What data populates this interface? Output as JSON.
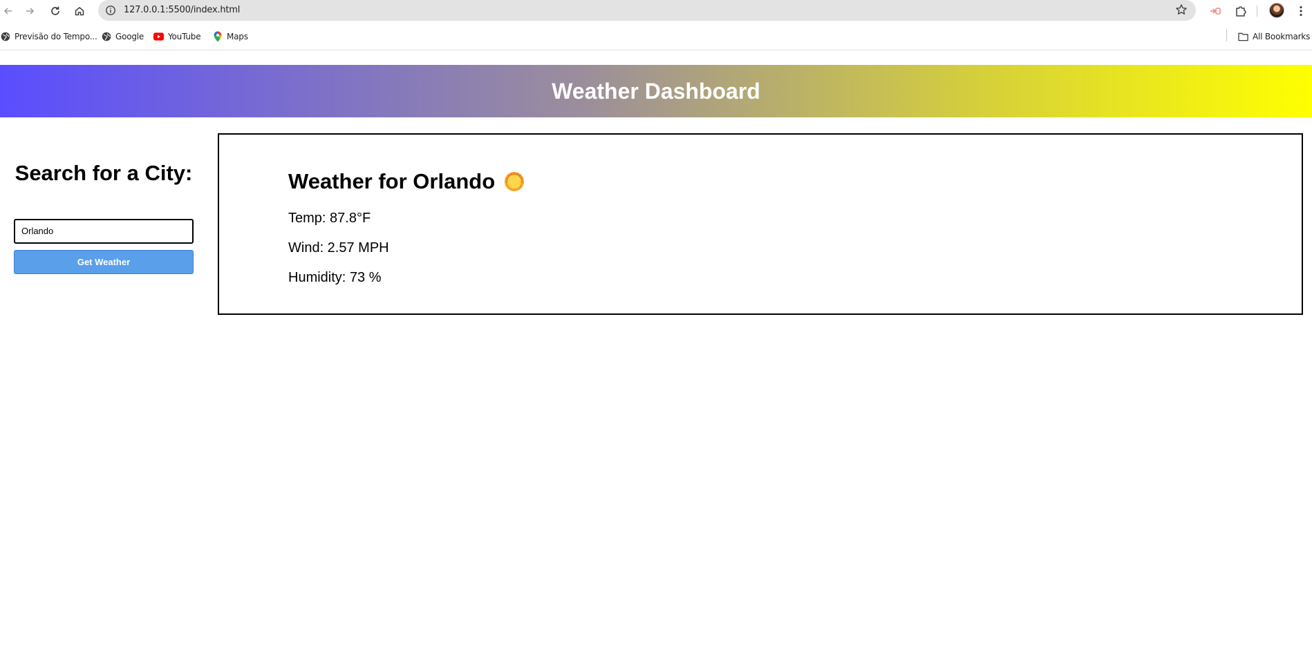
{
  "browser": {
    "url": "127.0.0.1:5500/index.html",
    "bookmarks": [
      {
        "label": "Previsão do Tempo...",
        "icon": "globe-icon"
      },
      {
        "label": "Google",
        "icon": "globe-icon"
      },
      {
        "label": "YouTube",
        "icon": "youtube-icon"
      },
      {
        "label": "Maps",
        "icon": "maps-pin-icon"
      }
    ],
    "all_bookmarks_label": "All Bookmarks"
  },
  "header": {
    "title": "Weather Dashboard",
    "gradient_colors": [
      "#5a4dff",
      "#ffff00"
    ]
  },
  "search": {
    "heading": "Search for a City:",
    "input_value": "Orlando",
    "button_label": "Get Weather",
    "button_color": "#5a9fea"
  },
  "weather": {
    "title": "Weather for Orlando",
    "icon": "sun-icon",
    "temp": "Temp: 87.8°F",
    "wind": "Wind: 2.57 MPH",
    "humidity": "Humidity: 73 %"
  }
}
